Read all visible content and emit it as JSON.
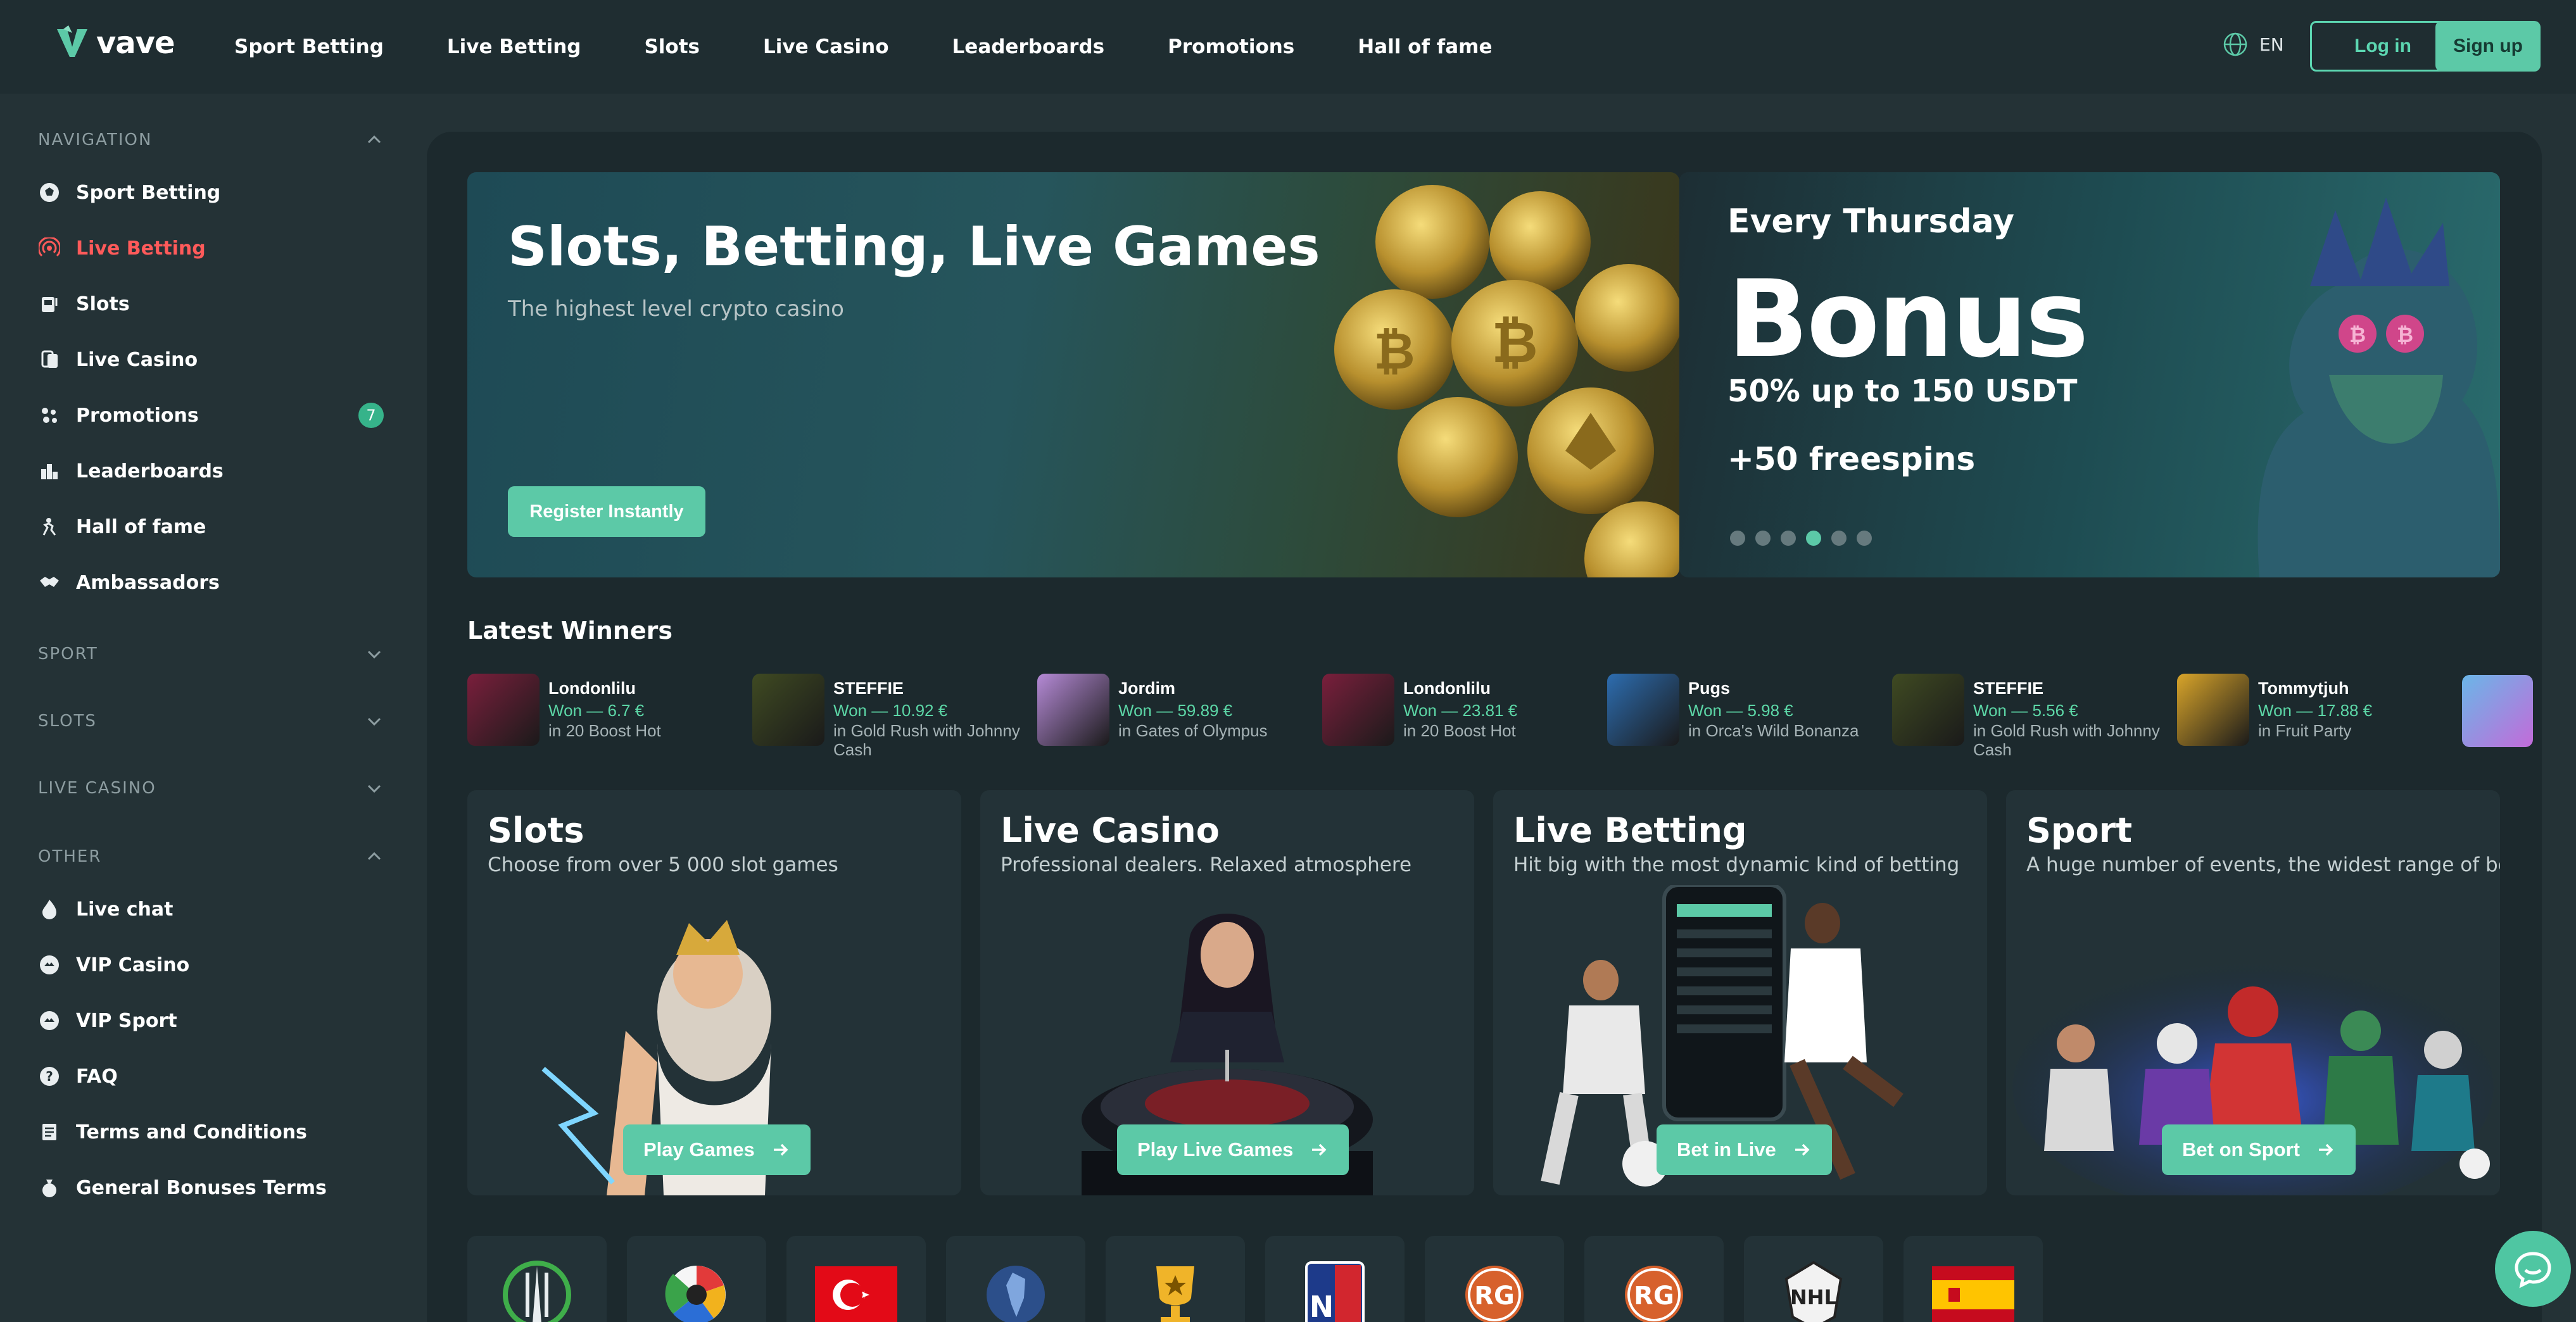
{
  "brand": {
    "name": "vave",
    "accent": "#5cc9a7",
    "active_color": "#ff5a5a"
  },
  "topnav": [
    "Sport Betting",
    "Live Betting",
    "Slots",
    "Live Casino",
    "Leaderboards",
    "Promotions",
    "Hall of fame"
  ],
  "header": {
    "lang": "EN",
    "login": "Log in",
    "signup": "Sign up"
  },
  "sidebar": {
    "navigation_title": "NAVIGATION",
    "items": [
      {
        "label": "Sport Betting",
        "icon": "soccer-ball-icon"
      },
      {
        "label": "Live Betting",
        "icon": "live-signal-icon",
        "active": true
      },
      {
        "label": "Slots",
        "icon": "slot-machine-icon"
      },
      {
        "label": "Live Casino",
        "icon": "cards-icon"
      },
      {
        "label": "Promotions",
        "icon": "gift-icon",
        "badge": "7"
      },
      {
        "label": "Leaderboards",
        "icon": "leaderboard-icon"
      },
      {
        "label": "Hall of fame",
        "icon": "hall-of-fame-icon"
      },
      {
        "label": "Ambassadors",
        "icon": "handshake-icon"
      }
    ],
    "sections": [
      "SPORT",
      "SLOTS",
      "LIVE CASINO"
    ],
    "other_title": "OTHER",
    "other_items": [
      {
        "label": "Live chat",
        "icon": "flame-icon"
      },
      {
        "label": "VIP Casino",
        "icon": "vip-icon"
      },
      {
        "label": "VIP Sport",
        "icon": "vip-icon"
      },
      {
        "label": "FAQ",
        "icon": "question-icon"
      },
      {
        "label": "Terms and Conditions",
        "icon": "document-icon"
      },
      {
        "label": "General Bonuses Terms",
        "icon": "bonus-terms-icon"
      }
    ]
  },
  "hero": {
    "title": "Slots, Betting, Live Games",
    "subtitle": "The highest level crypto casino",
    "cta": "Register Instantly"
  },
  "promo": {
    "kicker": "Every Thursday",
    "headline": "Bonus",
    "line1": "50% up to 150 USDT",
    "line2": "+50 freespins",
    "active_slide": 4
  },
  "winners": {
    "title": "Latest Winners",
    "items": [
      {
        "name": "Londonlilu",
        "won": "Won — 6.7 €",
        "game": "in 20 Boost Hot",
        "thumb": "#7a1f3c"
      },
      {
        "name": "STEFFIE",
        "won": "Won — 10.92 €",
        "game": "in Gold Rush with Johnny Cash",
        "thumb": "#3f4a22"
      },
      {
        "name": "Jordim",
        "won": "Won — 59.89 €",
        "game": "in Gates of Olympus",
        "thumb": "#b58ad6"
      },
      {
        "name": "Londonlilu",
        "won": "Won — 23.81 €",
        "game": "in 20 Boost Hot",
        "thumb": "#7a1f3c"
      },
      {
        "name": "Pugs",
        "won": "Won — 5.98 €",
        "game": "in Orca's Wild Bonanza",
        "thumb": "#2d6db0"
      },
      {
        "name": "STEFFIE",
        "won": "Won — 5.56 €",
        "game": "in Gold Rush with Johnny Cash",
        "thumb": "#3f4a22"
      },
      {
        "name": "Tommytjuh",
        "won": "Won — 17.88 €",
        "game": "in Fruit Party",
        "thumb": "#d9a52a"
      }
    ]
  },
  "cards": [
    {
      "title": "Slots",
      "subtitle": "Choose from over 5 000 slot games",
      "button": "Play Games"
    },
    {
      "title": "Live Casino",
      "subtitle": "Professional dealers. Relaxed atmosphere",
      "button": "Play Live Games"
    },
    {
      "title": "Live Betting",
      "subtitle": "Hit big with the most dynamic kind of betting",
      "button": "Bet in Live"
    },
    {
      "title": "Sport",
      "subtitle": "A huge number of events, the widest range of bets",
      "button": "Bet on Sport"
    }
  ],
  "leagues": [
    "conference-league-icon",
    "laliga-icon",
    "turkey-flag-icon",
    "copa-america-icon",
    "trophy-icon",
    "nba-style-icon",
    "roland-garros-icon",
    "roland-garros-icon",
    "nhl-icon",
    "spain-flag-icon"
  ]
}
